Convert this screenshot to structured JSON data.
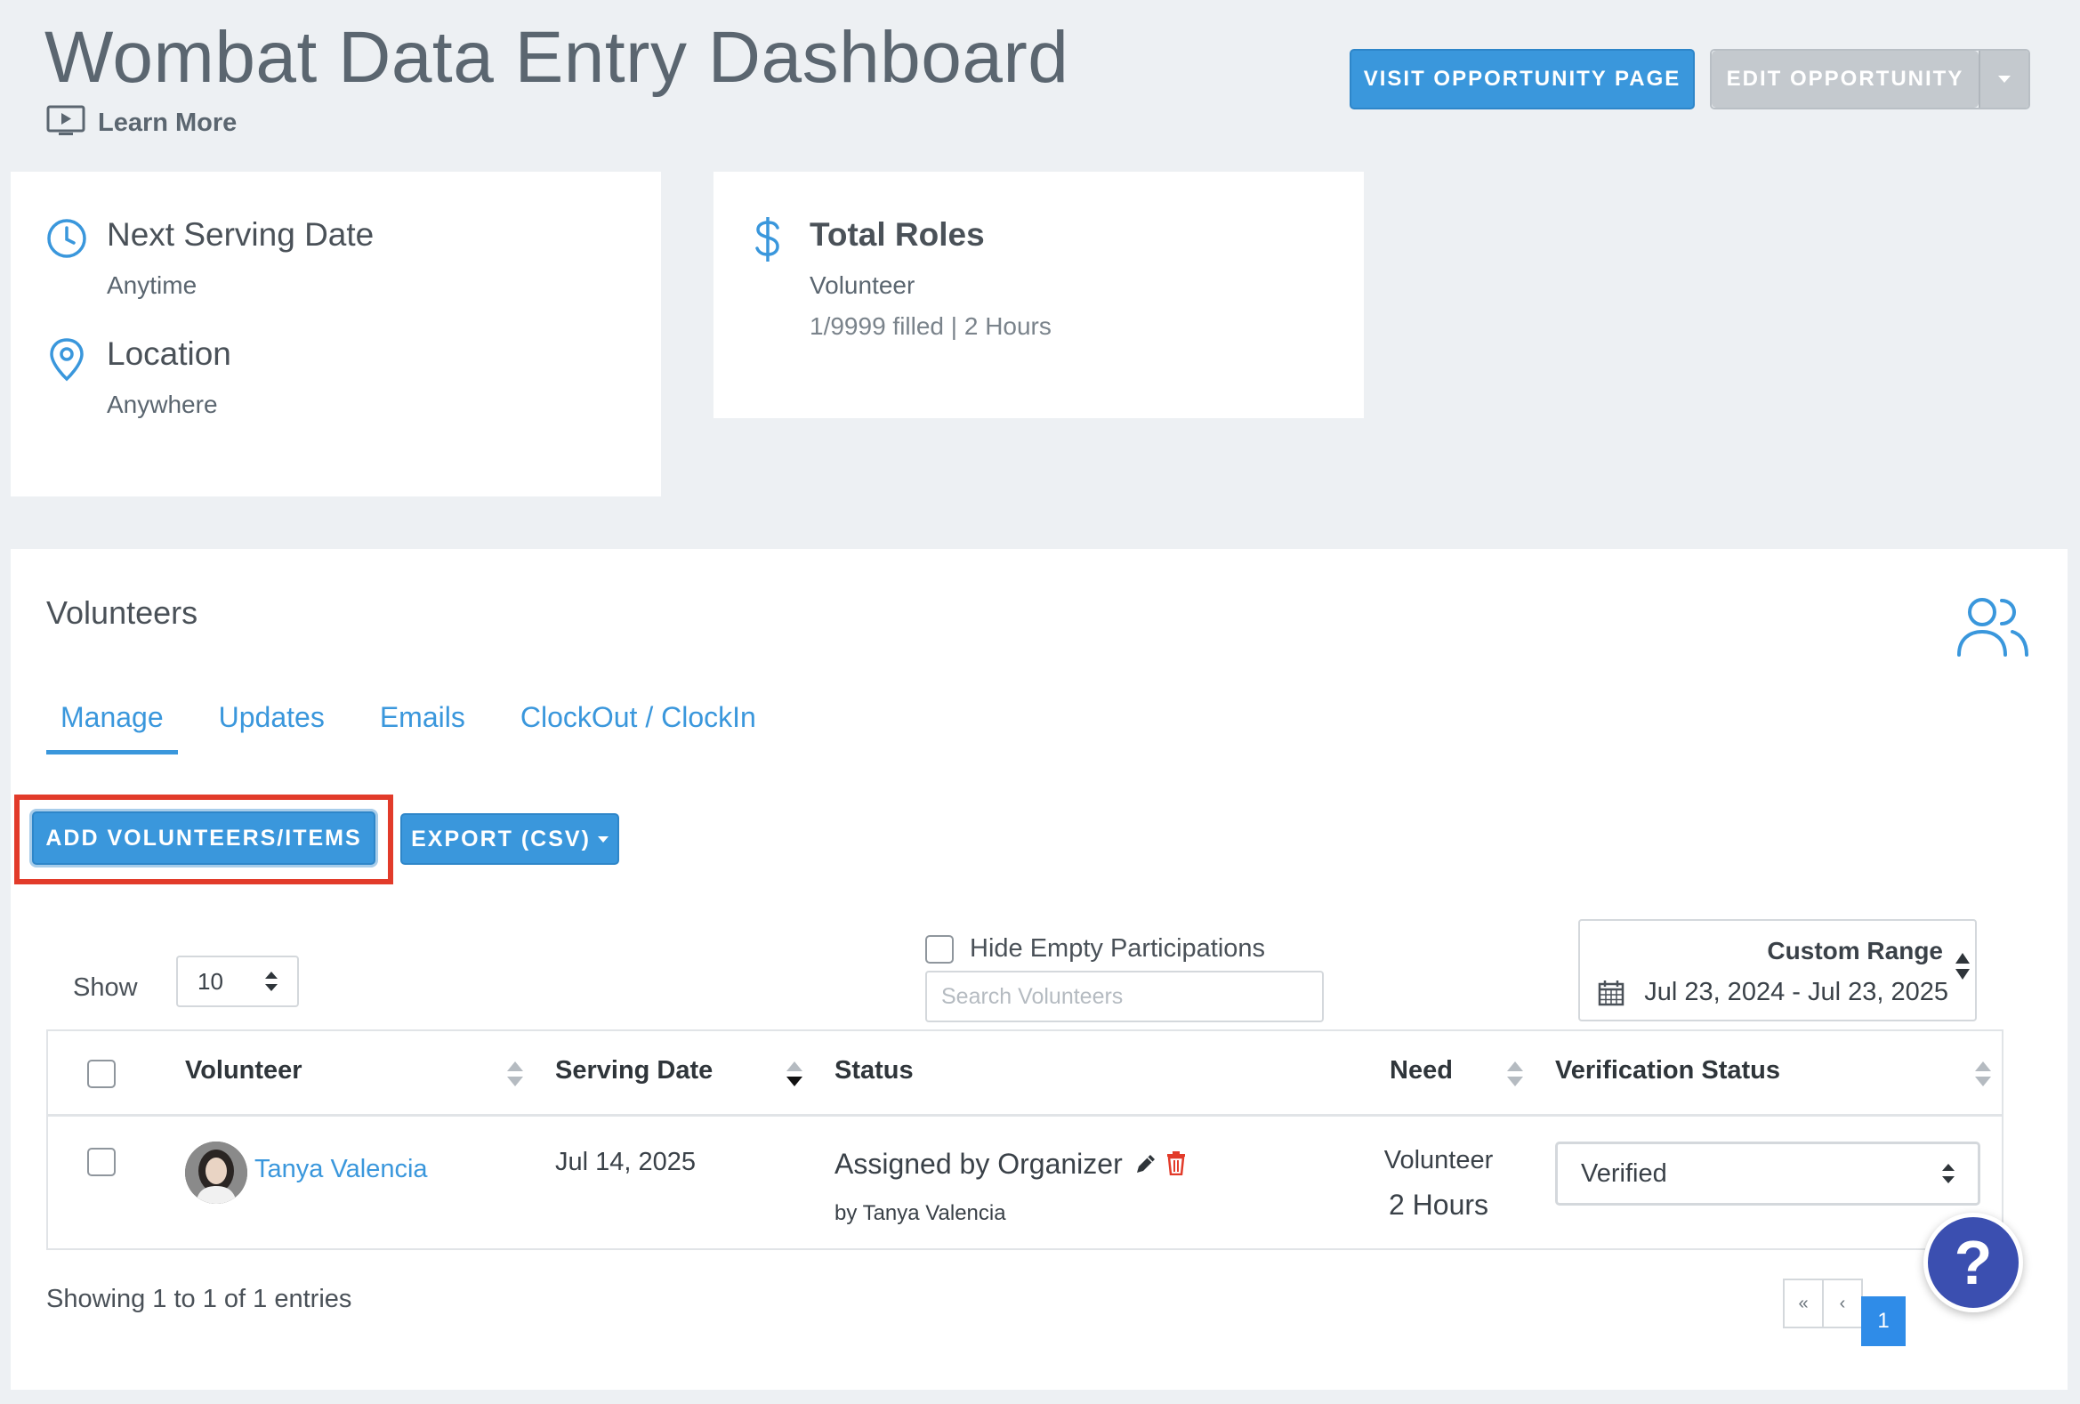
{
  "header": {
    "title": "Wombat Data Entry Dashboard",
    "learn_more": "Learn More",
    "visit_button": "VISIT OPPORTUNITY PAGE",
    "edit_button": "EDIT OPPORTUNITY"
  },
  "schedule_card": {
    "next_serving_label": "Next Serving Date",
    "next_serving_value": "Anytime",
    "location_label": "Location",
    "location_value": "Anywhere"
  },
  "roles_card": {
    "title": "Total Roles",
    "role_name": "Volunteer",
    "role_detail": "1/9999 filled | 2 Hours"
  },
  "volunteers": {
    "title": "Volunteers",
    "tabs": [
      {
        "label": "Manage",
        "active": true
      },
      {
        "label": "Updates",
        "active": false
      },
      {
        "label": "Emails",
        "active": false
      },
      {
        "label": "ClockOut / ClockIn",
        "active": false
      }
    ],
    "add_button": "ADD VOLUNTEERS/ITEMS",
    "export_button": "EXPORT (CSV)",
    "show_label": "Show",
    "show_value": "10",
    "hide_empty_label": "Hide Empty Participations",
    "search_placeholder": "Search Volunteers",
    "range_title": "Custom Range",
    "range_dates": "Jul 23, 2024 - Jul 23, 2025",
    "columns": [
      "Volunteer",
      "Serving Date",
      "Status",
      "Need",
      "Verification Status"
    ],
    "rows": [
      {
        "name": "Tanya Valencia",
        "serving_date": "Jul 14, 2025",
        "status": "Assigned by Organizer",
        "status_by": "by Tanya Valencia",
        "need_role": "Volunteer",
        "need_hours": "2 Hours",
        "verification": "Verified"
      }
    ],
    "showing_text": "Showing 1 to 1 of 1 entries",
    "pager": {
      "first": "«",
      "prev": "‹",
      "current": "1"
    }
  },
  "help_button": "?",
  "colors": {
    "accent": "#3a97dc",
    "highlight": "#e23b2a",
    "help": "#3b4fb0"
  }
}
